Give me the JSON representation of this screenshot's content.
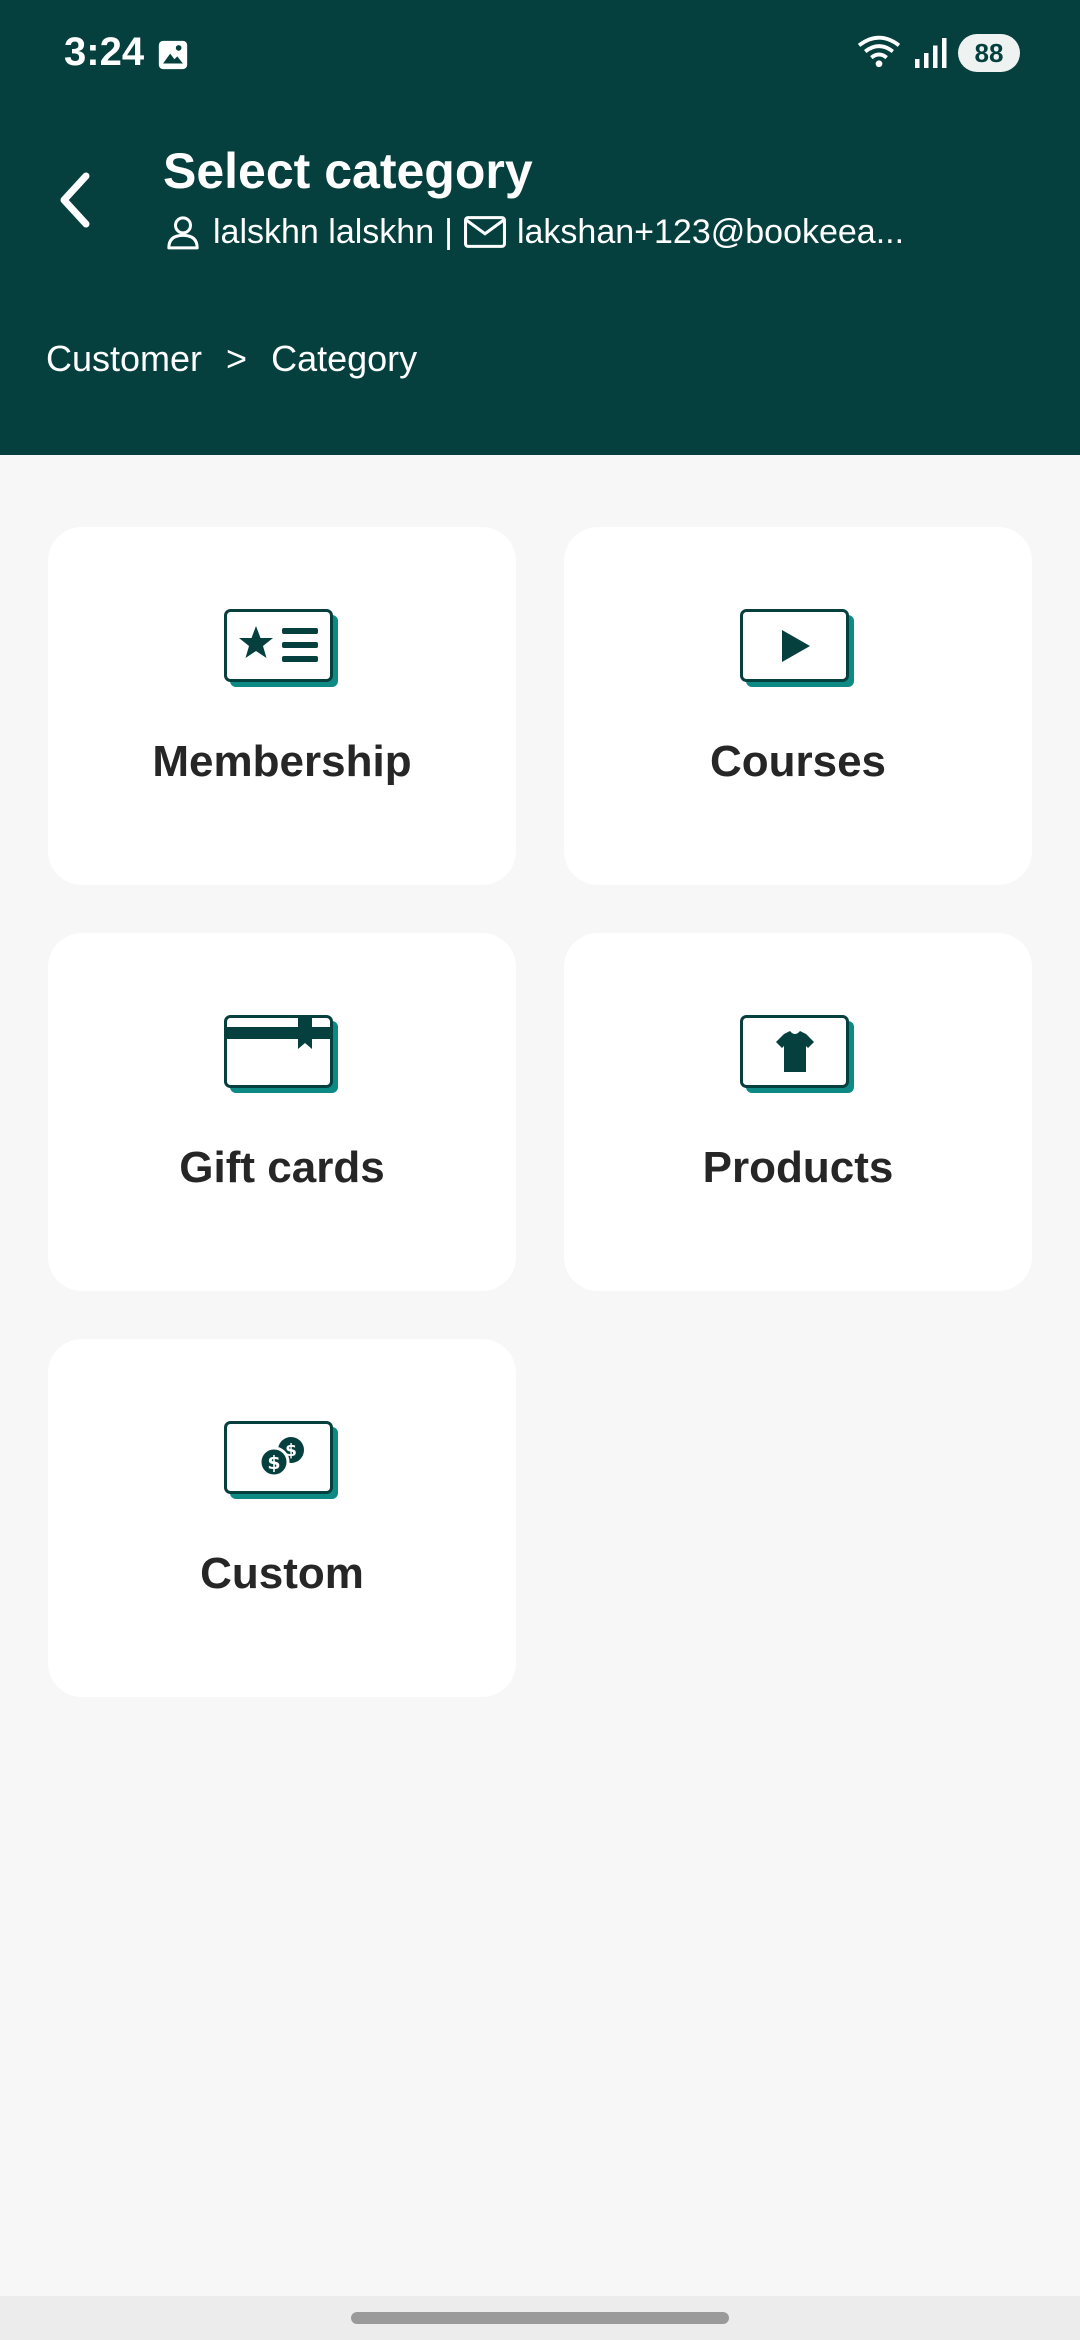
{
  "status_bar": {
    "time": "3:24",
    "battery": "88",
    "icons": [
      "photo-icon",
      "wifi-icon",
      "signal-icon",
      "battery-icon"
    ]
  },
  "header": {
    "title": "Select category",
    "customer_name": "lalskhn lalskhn",
    "separator": "|",
    "customer_email": "lakshan+123@bookeea...",
    "background_color": "#05403e"
  },
  "breadcrumb": {
    "items": [
      "Customer",
      "Category"
    ],
    "separator": ">"
  },
  "categories": [
    {
      "label": "Membership",
      "icon": "membership-card-icon"
    },
    {
      "label": "Courses",
      "icon": "video-play-icon"
    },
    {
      "label": "Gift cards",
      "icon": "gift-card-icon"
    },
    {
      "label": "Products",
      "icon": "tshirt-icon"
    },
    {
      "label": "Custom",
      "icon": "dollar-coins-icon"
    }
  ],
  "colors": {
    "icon_dark": "#05403e",
    "icon_accent": "#0e8a85",
    "card_background": "#ffffff",
    "page_background": "#f7f7f7"
  }
}
